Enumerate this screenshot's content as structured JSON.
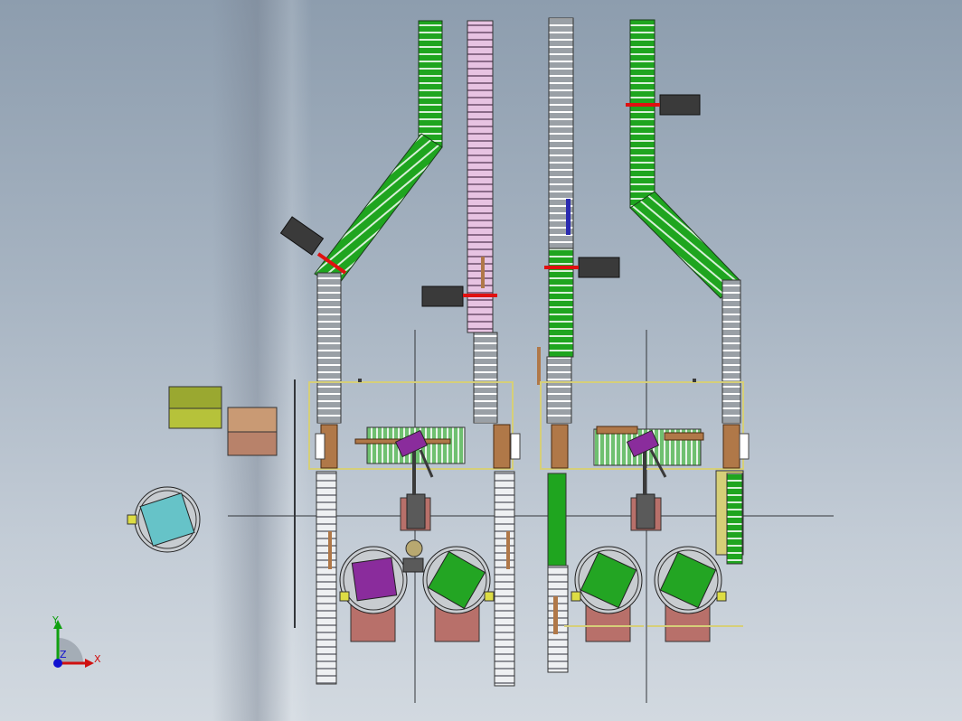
{
  "view": {
    "background_top": "#8d9dae",
    "background_bottom": "#d2d9e0"
  },
  "triad": {
    "x_label": "X",
    "y_label": "Y",
    "z_label": "Z",
    "x_color": "#d01010",
    "y_color": "#10a010",
    "z_color": "#1010d0"
  },
  "colors": {
    "green_conveyor": "#1fa51f",
    "pink_conveyor": "#e7c3e2",
    "gray_conveyor": "#8a8f94",
    "white_conveyor": "#eceff2",
    "robot_base": "#b8706a",
    "pallet_green": "#23a523",
    "pallet_purple": "#8a2c9c",
    "pallet_cyan": "#66c3c8",
    "scanner_box": "#3a3a3a",
    "stop_bar": "#e01010",
    "guard_rail": "#d6cf78",
    "cardboard": "#b07848"
  },
  "icons": {
    "triad": "coordinate-triad-icon"
  }
}
